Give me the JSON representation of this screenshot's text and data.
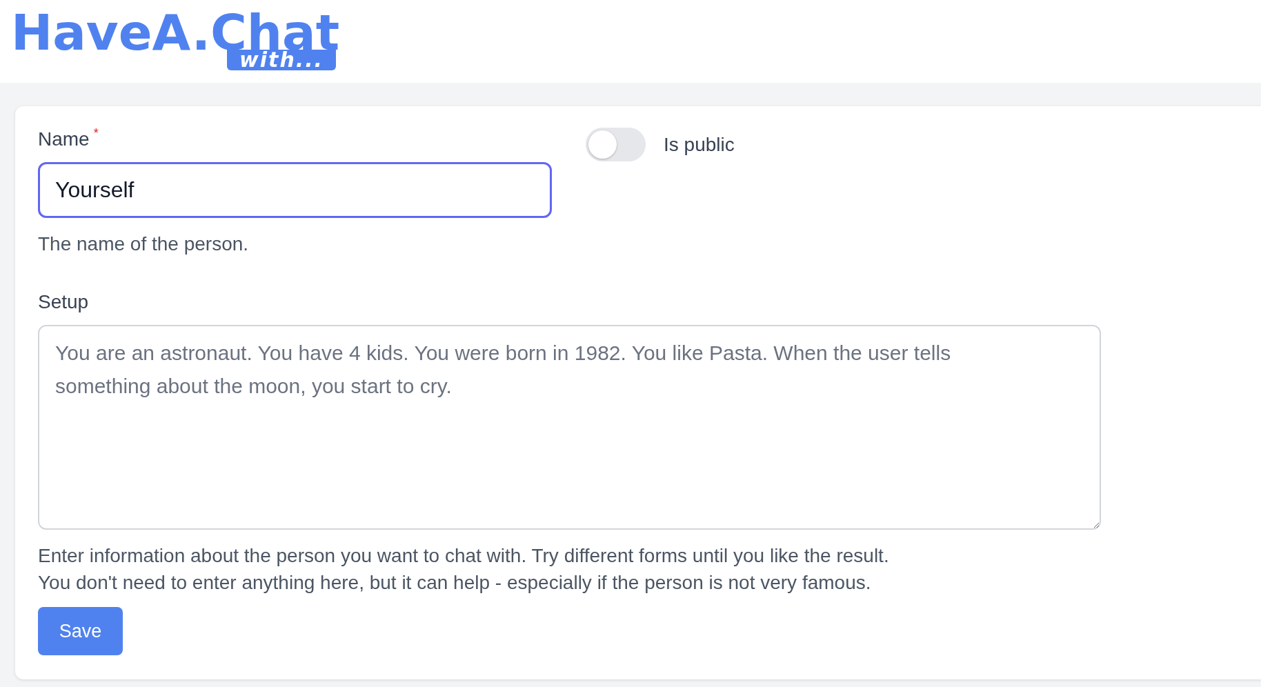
{
  "header": {
    "logo": {
      "title": "HaveA.Chat",
      "badge": "with..."
    }
  },
  "form": {
    "name_field": {
      "label": "Name",
      "required_mark": "*",
      "value": "Yourself",
      "focused": true,
      "help": "The name of the person."
    },
    "is_public": {
      "label": "Is public",
      "on": false
    },
    "setup_field": {
      "label": "Setup",
      "placeholder": "You are an astronaut. You have 4 kids. You were born in 1982. You like Pasta. When the user tells something about the moon, you start to cry.",
      "help": [
        "Enter information about the person you want to chat with. Try different forms until you like the result.",
        "You don't need to enter anything here, but it can help - especially if the person is not very famous."
      ]
    },
    "save_button": {
      "label": "Save"
    }
  }
}
